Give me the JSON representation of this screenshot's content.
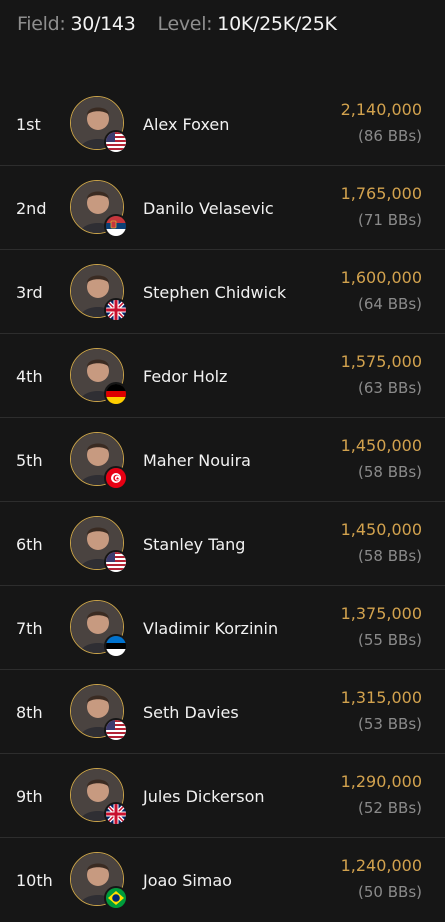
{
  "header": {
    "field_label": "Field:",
    "field_value": "30/143",
    "level_label": "Level:",
    "level_value": "10K/25K/25K"
  },
  "players": [
    {
      "rank": "1st",
      "name": "Alex Foxen",
      "chips": "2,140,000",
      "bbs": "(86 BBs)",
      "flag": "us-flag-icon"
    },
    {
      "rank": "2nd",
      "name": "Danilo Velasevic",
      "chips": "1,765,000",
      "bbs": "(71 BBs)",
      "flag": "serbia-flag-icon"
    },
    {
      "rank": "3rd",
      "name": "Stephen Chidwick",
      "chips": "1,600,000",
      "bbs": "(64 BBs)",
      "flag": "uk-flag-icon"
    },
    {
      "rank": "4th",
      "name": "Fedor Holz",
      "chips": "1,575,000",
      "bbs": "(63 BBs)",
      "flag": "germany-flag-icon"
    },
    {
      "rank": "5th",
      "name": "Maher Nouira",
      "chips": "1,450,000",
      "bbs": "(58 BBs)",
      "flag": "tunisia-flag-icon"
    },
    {
      "rank": "6th",
      "name": "Stanley Tang",
      "chips": "1,450,000",
      "bbs": "(58 BBs)",
      "flag": "us-flag-icon"
    },
    {
      "rank": "7th",
      "name": "Vladimir Korzinin",
      "chips": "1,375,000",
      "bbs": "(55 BBs)",
      "flag": "estonia-flag-icon"
    },
    {
      "rank": "8th",
      "name": "Seth Davies",
      "chips": "1,315,000",
      "bbs": "(53 BBs)",
      "flag": "us-flag-icon"
    },
    {
      "rank": "9th",
      "name": "Jules Dickerson",
      "chips": "1,290,000",
      "bbs": "(52 BBs)",
      "flag": "uk-flag-icon"
    },
    {
      "rank": "10th",
      "name": "Joao Simao",
      "chips": "1,240,000",
      "bbs": "(50 BBs)",
      "flag": "brazil-flag-icon"
    }
  ],
  "colors": {
    "background": "#161616",
    "chips": "#d2a24e",
    "muted": "#8a8a8a",
    "avatar_ring": "#c9a34a"
  }
}
